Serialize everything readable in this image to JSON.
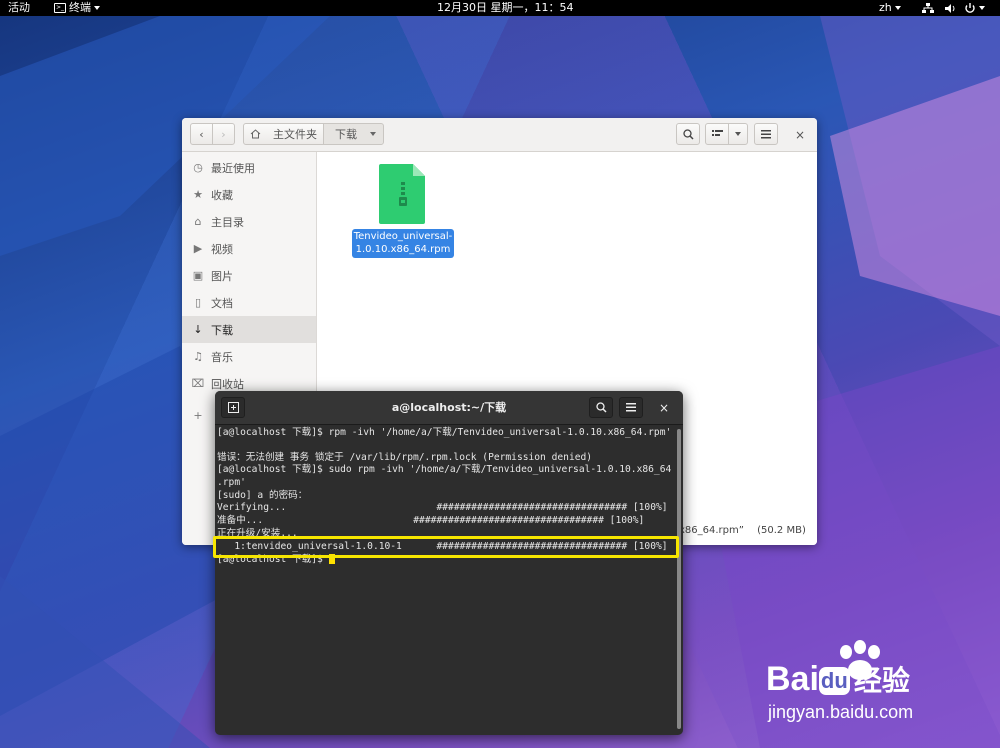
{
  "topbar": {
    "activities": "活动",
    "app_menu": "终端",
    "clock": "12月30日 星期一，11：54",
    "lang": "zh"
  },
  "files": {
    "breadcrumb_home": "主文件夹",
    "breadcrumb_current": "下载",
    "sidebar": [
      {
        "icon": "clock-icon",
        "label": "最近使用"
      },
      {
        "icon": "star-icon",
        "label": "收藏"
      },
      {
        "icon": "home-icon",
        "label": "主目录"
      },
      {
        "icon": "video-icon",
        "label": "视频"
      },
      {
        "icon": "image-icon",
        "label": "图片"
      },
      {
        "icon": "document-icon",
        "label": "文档"
      },
      {
        "icon": "download-icon",
        "label": "下载",
        "active": true
      },
      {
        "icon": "music-icon",
        "label": "音乐"
      },
      {
        "icon": "trash-icon",
        "label": "回收站"
      }
    ],
    "file_name": "Tenvideo_universal-1.0.10.x86_64.rpm",
    "file_name_line1": "Tenvideo_universal-",
    "file_name_line2": "1.0.10.x86_64.rpm",
    "status_name_fragment": "x86_64.rpm”",
    "status_size": "(50.2 MB)"
  },
  "terminal": {
    "title": "a@localhost:~/下载",
    "lines": [
      "[a@localhost 下载]$ rpm -ivh '/home/a/下载/Tenvideo_universal-1.0.10.x86_64.rpm'",
      "",
      "错误：无法创建 事务 锁定于 /var/lib/rpm/.rpm.lock (Permission denied)",
      "[a@localhost 下载]$ sudo rpm -ivh '/home/a/下载/Tenvideo_universal-1.0.10.x86_64",
      ".rpm'",
      "[sudo] a 的密码：",
      "Verifying...                          ################################# [100%]",
      "准备中...                          ################################# [100%]",
      "正在升级/安装...",
      "   1:tenvideo_universal-1.0.10-1      ################################# [100%]",
      "[a@localhost 下载]$ "
    ]
  },
  "watermark": {
    "brand": "Bai",
    "brand_du": "du",
    "brand_cn": "经验",
    "url": "jingyan.baidu.com"
  },
  "colors": {
    "accent": "#3584e4",
    "highlight": "#f7e600",
    "file_icon": "#2ecc71"
  }
}
